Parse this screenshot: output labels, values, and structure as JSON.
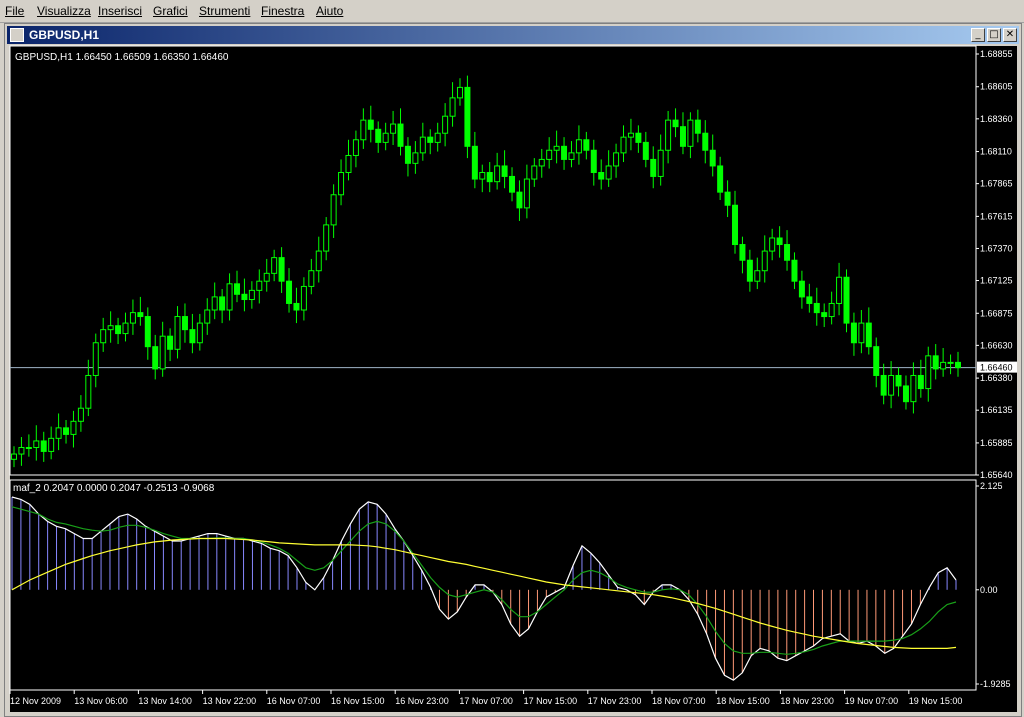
{
  "menubar": {
    "items": [
      "File",
      "Visualizza",
      "Inserisci",
      "Grafici",
      "Strumenti",
      "Finestra",
      "Aiuto"
    ]
  },
  "window": {
    "title": "GBPUSD,H1",
    "buttons": {
      "minimize": "_",
      "maximize": "□",
      "close": "✕"
    }
  },
  "colors": {
    "background": "#000000",
    "bull": "#00ff00",
    "bear": "#00ff00",
    "text": "#ffffff",
    "bidline": "#a0b4c8",
    "histo_pos": "#8888ff",
    "histo_neg": "#ff9977",
    "line_white": "#ffffff",
    "line_green": "#19a019",
    "line_yellow": "#ffff33"
  },
  "chart_data": [
    {
      "type": "candlestick",
      "title": "GBPUSD,H1  1.66450 1.66509 1.66350 1.66460",
      "ylim": [
        1.6564,
        1.68855
      ],
      "y_ticks": [
        "1.68855",
        "1.68605",
        "1.68360",
        "1.68110",
        "1.67865",
        "1.67615",
        "1.67370",
        "1.67125",
        "1.66875",
        "1.66630",
        "1.66380",
        "1.66135",
        "1.65885",
        "1.65640"
      ],
      "current_price": "1.66460",
      "x_ticks": [
        "12 Nov 2009",
        "13 Nov 06:00",
        "13 Nov 14:00",
        "13 Nov 22:00",
        "16 Nov 07:00",
        "16 Nov 15:00",
        "16 Nov 23:00",
        "17 Nov 07:00",
        "17 Nov 15:00",
        "17 Nov 23:00",
        "18 Nov 07:00",
        "18 Nov 15:00",
        "18 Nov 23:00",
        "19 Nov 07:00",
        "19 Nov 15:00"
      ],
      "close": [
        1.658,
        1.6585,
        1.6585,
        1.659,
        1.6582,
        1.6592,
        1.66,
        1.6595,
        1.6605,
        1.6615,
        1.664,
        1.6665,
        1.6675,
        1.6678,
        1.6672,
        1.668,
        1.6688,
        1.6685,
        1.6662,
        1.6645,
        1.667,
        1.666,
        1.6685,
        1.6675,
        1.6665,
        1.668,
        1.669,
        1.67,
        1.669,
        1.671,
        1.6702,
        1.6698,
        1.6705,
        1.6712,
        1.6718,
        1.673,
        1.6712,
        1.6695,
        1.669,
        1.6708,
        1.672,
        1.6735,
        1.6755,
        1.6778,
        1.6795,
        1.6808,
        1.682,
        1.6835,
        1.6828,
        1.6818,
        1.6825,
        1.6832,
        1.6815,
        1.6802,
        1.681,
        1.6822,
        1.6818,
        1.6825,
        1.6838,
        1.6852,
        1.686,
        1.6815,
        1.679,
        1.6795,
        1.6788,
        1.68,
        1.6792,
        1.678,
        1.6768,
        1.679,
        1.68,
        1.6805,
        1.6812,
        1.6815,
        1.6805,
        1.681,
        1.682,
        1.6812,
        1.6795,
        1.679,
        1.68,
        1.681,
        1.6822,
        1.6825,
        1.6818,
        1.6805,
        1.6792,
        1.6812,
        1.6835,
        1.683,
        1.6815,
        1.6835,
        1.6825,
        1.6812,
        1.68,
        1.678,
        1.677,
        1.674,
        1.6728,
        1.6712,
        1.672,
        1.6735,
        1.6745,
        1.674,
        1.6728,
        1.6712,
        1.67,
        1.6695,
        1.6688,
        1.6685,
        1.6695,
        1.6715,
        1.668,
        1.6665,
        1.668,
        1.6662,
        1.664,
        1.6625,
        1.664,
        1.6632,
        1.662,
        1.664,
        1.663,
        1.6655,
        1.6645,
        1.665,
        1.665,
        1.6646
      ],
      "series_count_note": ""
    },
    {
      "type": "line",
      "title": "maf_2 0.2047 0.0000 0.2047 -0.2513 -0.9068",
      "ylim": [
        -1.9285,
        2.125
      ],
      "y_ticks": [
        "2.125",
        "0.00",
        "-1.9285"
      ],
      "series": [
        {
          "name": "",
          "style": "histogram",
          "values": [
            1.9,
            1.85,
            1.75,
            1.55,
            1.4,
            1.3,
            1.25,
            1.15,
            1.05,
            1.05,
            1.2,
            1.35,
            1.5,
            1.55,
            1.45,
            1.3,
            1.2,
            1.1,
            1.0,
            1.0,
            1.05,
            1.1,
            1.15,
            1.15,
            1.1,
            1.05,
            1.05,
            1.0,
            0.95,
            0.85,
            0.8,
            0.7,
            0.45,
            0.15,
            0.0,
            0.25,
            0.6,
            1.0,
            1.35,
            1.65,
            1.8,
            1.75,
            1.55,
            1.25,
            1.0,
            0.7,
            0.4,
            0.05,
            -0.4,
            -0.6,
            -0.45,
            -0.15,
            0.1,
            0.1,
            -0.05,
            -0.3,
            -0.7,
            -0.95,
            -0.8,
            -0.45,
            -0.15,
            -0.05,
            0.05,
            0.5,
            0.9,
            0.75,
            0.55,
            0.3,
            0.05,
            0.0,
            -0.1,
            -0.3,
            -0.05,
            0.1,
            0.1,
            0.0,
            -0.2,
            -0.5,
            -0.9,
            -1.4,
            -1.75,
            -1.85,
            -1.7,
            -1.35,
            -1.2,
            -1.25,
            -1.4,
            -1.45,
            -1.35,
            -1.25,
            -1.15,
            -1.0,
            -0.95,
            -0.9,
            -1.05,
            -1.1,
            -1.05,
            -1.15,
            -1.3,
            -1.2,
            -0.95,
            -0.7,
            -0.3,
            0.05,
            0.35,
            0.45,
            0.2
          ]
        },
        {
          "name": "",
          "style": "line_white",
          "values": [
            1.9,
            1.85,
            1.75,
            1.55,
            1.4,
            1.3,
            1.25,
            1.15,
            1.05,
            1.05,
            1.2,
            1.35,
            1.5,
            1.55,
            1.45,
            1.3,
            1.2,
            1.1,
            1.0,
            1.0,
            1.05,
            1.1,
            1.15,
            1.15,
            1.1,
            1.05,
            1.05,
            1.0,
            0.95,
            0.85,
            0.8,
            0.7,
            0.45,
            0.15,
            0.0,
            0.25,
            0.6,
            1.0,
            1.35,
            1.65,
            1.8,
            1.75,
            1.55,
            1.25,
            1.0,
            0.7,
            0.4,
            0.05,
            -0.4,
            -0.6,
            -0.45,
            -0.15,
            0.1,
            0.1,
            -0.05,
            -0.3,
            -0.7,
            -0.95,
            -0.8,
            -0.45,
            -0.15,
            -0.05,
            0.05,
            0.5,
            0.9,
            0.75,
            0.55,
            0.3,
            0.05,
            0.0,
            -0.1,
            -0.3,
            -0.05,
            0.1,
            0.1,
            0.0,
            -0.2,
            -0.5,
            -0.9,
            -1.4,
            -1.75,
            -1.85,
            -1.7,
            -1.35,
            -1.2,
            -1.25,
            -1.4,
            -1.45,
            -1.35,
            -1.25,
            -1.15,
            -1.0,
            -0.95,
            -0.9,
            -1.05,
            -1.1,
            -1.05,
            -1.15,
            -1.3,
            -1.2,
            -0.95,
            -0.7,
            -0.3,
            0.05,
            0.35,
            0.45,
            0.2
          ]
        },
        {
          "name": "",
          "style": "line_green",
          "values": [
            1.7,
            1.65,
            1.6,
            1.55,
            1.45,
            1.38,
            1.35,
            1.3,
            1.25,
            1.22,
            1.2,
            1.22,
            1.28,
            1.32,
            1.32,
            1.28,
            1.22,
            1.15,
            1.1,
            1.05,
            1.05,
            1.05,
            1.05,
            1.06,
            1.06,
            1.05,
            1.05,
            1.02,
            0.98,
            0.92,
            0.85,
            0.75,
            0.6,
            0.45,
            0.4,
            0.45,
            0.6,
            0.8,
            1.0,
            1.2,
            1.35,
            1.4,
            1.35,
            1.2,
            1.0,
            0.75,
            0.5,
            0.25,
            0.05,
            -0.1,
            -0.15,
            -0.1,
            -0.05,
            0.0,
            -0.05,
            -0.2,
            -0.4,
            -0.55,
            -0.55,
            -0.45,
            -0.3,
            -0.15,
            0.0,
            0.2,
            0.35,
            0.4,
            0.35,
            0.25,
            0.12,
            0.05,
            0.0,
            -0.05,
            -0.05,
            0.0,
            0.02,
            0.0,
            -0.1,
            -0.3,
            -0.55,
            -0.85,
            -1.1,
            -1.25,
            -1.3,
            -1.3,
            -1.28,
            -1.28,
            -1.3,
            -1.32,
            -1.3,
            -1.27,
            -1.22,
            -1.15,
            -1.1,
            -1.05,
            -1.05,
            -1.05,
            -1.05,
            -1.05,
            -1.05,
            -1.03,
            -1.0,
            -0.92,
            -0.8,
            -0.65,
            -0.45,
            -0.3,
            -0.25
          ]
        },
        {
          "name": "",
          "style": "line_yellow",
          "values": [
            0.0,
            0.1,
            0.2,
            0.28,
            0.36,
            0.44,
            0.52,
            0.58,
            0.64,
            0.7,
            0.75,
            0.8,
            0.84,
            0.88,
            0.92,
            0.95,
            0.98,
            1.0,
            1.02,
            1.03,
            1.04,
            1.05,
            1.05,
            1.05,
            1.05,
            1.04,
            1.03,
            1.02,
            1.0,
            0.98,
            0.96,
            0.95,
            0.94,
            0.93,
            0.92,
            0.92,
            0.92,
            0.92,
            0.92,
            0.91,
            0.9,
            0.88,
            0.85,
            0.82,
            0.78,
            0.74,
            0.7,
            0.66,
            0.62,
            0.58,
            0.55,
            0.52,
            0.48,
            0.44,
            0.4,
            0.36,
            0.32,
            0.28,
            0.24,
            0.2,
            0.16,
            0.13,
            0.1,
            0.08,
            0.06,
            0.04,
            0.02,
            0.0,
            -0.02,
            -0.04,
            -0.06,
            -0.08,
            -0.1,
            -0.13,
            -0.16,
            -0.2,
            -0.24,
            -0.28,
            -0.33,
            -0.38,
            -0.44,
            -0.5,
            -0.56,
            -0.62,
            -0.68,
            -0.73,
            -0.78,
            -0.83,
            -0.87,
            -0.91,
            -0.95,
            -0.98,
            -1.01,
            -1.04,
            -1.07,
            -1.1,
            -1.12,
            -1.14,
            -1.16,
            -1.18,
            -1.19,
            -1.2,
            -1.2,
            -1.2,
            -1.2,
            -1.2,
            -1.18
          ]
        }
      ]
    }
  ]
}
